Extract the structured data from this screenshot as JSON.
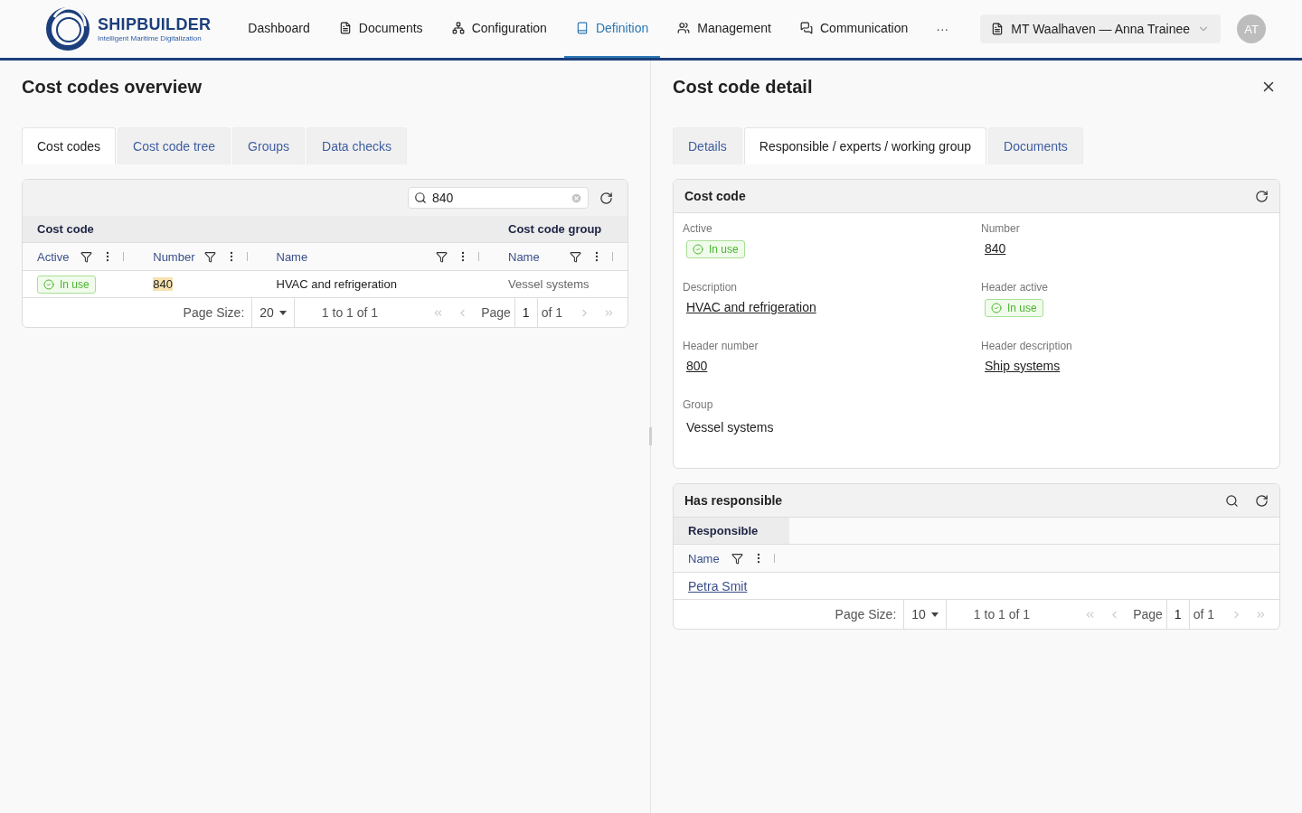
{
  "brand": {
    "title": "SHIPBUILDER",
    "tagline": "Intelligent Maritime Digitalization"
  },
  "nav": [
    {
      "label": "Dashboard",
      "selected": false
    },
    {
      "label": "Documents",
      "selected": false
    },
    {
      "label": "Configuration",
      "selected": false
    },
    {
      "label": "Definition",
      "selected": true
    },
    {
      "label": "Management",
      "selected": false
    },
    {
      "label": "Communication",
      "selected": false
    }
  ],
  "nav_more": "···",
  "context": {
    "label": "MT Waalhaven — Anna Trainee"
  },
  "avatar": "AT",
  "overview": {
    "title": "Cost codes overview",
    "tabs": [
      {
        "label": "Cost codes",
        "selected": true
      },
      {
        "label": "Cost code tree",
        "selected": false
      },
      {
        "label": "Groups",
        "selected": false
      },
      {
        "label": "Data checks",
        "selected": false
      }
    ],
    "search": {
      "value": "840"
    },
    "table": {
      "groups": [
        {
          "label": "Cost code"
        },
        {
          "label": "Cost code group"
        }
      ],
      "columns": [
        {
          "label": "Active"
        },
        {
          "label": "Number"
        },
        {
          "label": "Name"
        },
        {
          "label": "Name"
        }
      ],
      "rows": [
        {
          "active": "In use",
          "number": "840",
          "number_highlighted": true,
          "name": "HVAC and refrigeration",
          "group_name": "Vessel systems"
        }
      ]
    },
    "pager": {
      "size_label": "Page Size:",
      "size": "20",
      "range": "1 to 1 of 1",
      "page_label": "Page",
      "page": "1",
      "of": "of 1"
    }
  },
  "detail": {
    "title": "Cost code detail",
    "tabs": [
      {
        "label": "Details",
        "selected": false
      },
      {
        "label": "Responsible / experts / working group",
        "selected": true
      },
      {
        "label": "Documents",
        "selected": false
      }
    ],
    "card": {
      "title": "Cost code",
      "fields": [
        {
          "label": "Active",
          "kind": "badge",
          "value": "In use"
        },
        {
          "label": "Number",
          "kind": "link",
          "value": "840"
        },
        {
          "label": "Description",
          "kind": "link",
          "value": "HVAC and refrigeration"
        },
        {
          "label": "Header active",
          "kind": "badge",
          "value": "In use"
        },
        {
          "label": "Header number",
          "kind": "link",
          "value": "800"
        },
        {
          "label": "Header description",
          "kind": "link",
          "value": "Ship systems"
        },
        {
          "label": "Group",
          "kind": "text",
          "value": "Vessel systems"
        }
      ]
    },
    "responsible": {
      "title": "Has responsible",
      "group": "Responsible",
      "column": "Name",
      "rows": [
        {
          "name": "Petra Smit"
        }
      ],
      "pager": {
        "size_label": "Page Size:",
        "size": "10",
        "range": "1 to 1 of 1",
        "page_label": "Page",
        "page": "1",
        "of": "of 1"
      }
    }
  }
}
